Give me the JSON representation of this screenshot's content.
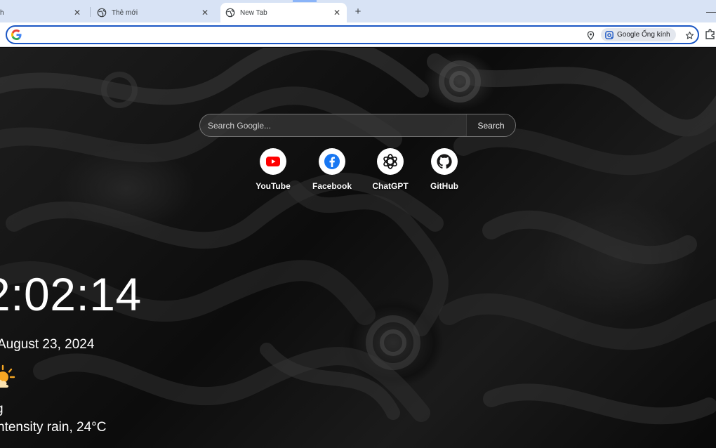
{
  "browser": {
    "tabs": [
      {
        "title": "h",
        "active": false
      },
      {
        "title": "Thẻ mới",
        "active": false
      },
      {
        "title": "New Tab",
        "active": true
      }
    ],
    "new_tab_symbol": "+",
    "close_symbol": "✕",
    "minimize_symbol": "—",
    "omnibox": {
      "value": "",
      "placeholder": "",
      "lens_chip_label": "Google Ống kính"
    },
    "accent_color": "#1a56c4"
  },
  "page": {
    "search": {
      "placeholder": "Search Google...",
      "button_label": "Search"
    },
    "shortcuts": [
      {
        "label": "YouTube",
        "icon": "youtube-icon",
        "color": "#ff0000"
      },
      {
        "label": "Facebook",
        "icon": "facebook-icon",
        "color": "#1877f2"
      },
      {
        "label": "ChatGPT",
        "icon": "chatgpt-icon",
        "color": "#000000"
      },
      {
        "label": "GitHub",
        "icon": "github-icon",
        "color": "#181717"
      }
    ],
    "clock": {
      "time": "2:02:14",
      "date": "August 23, 2024"
    },
    "weather": {
      "icon": "sun-cloud-icon",
      "location": "g",
      "description": "ntensity rain, 24°C"
    }
  }
}
